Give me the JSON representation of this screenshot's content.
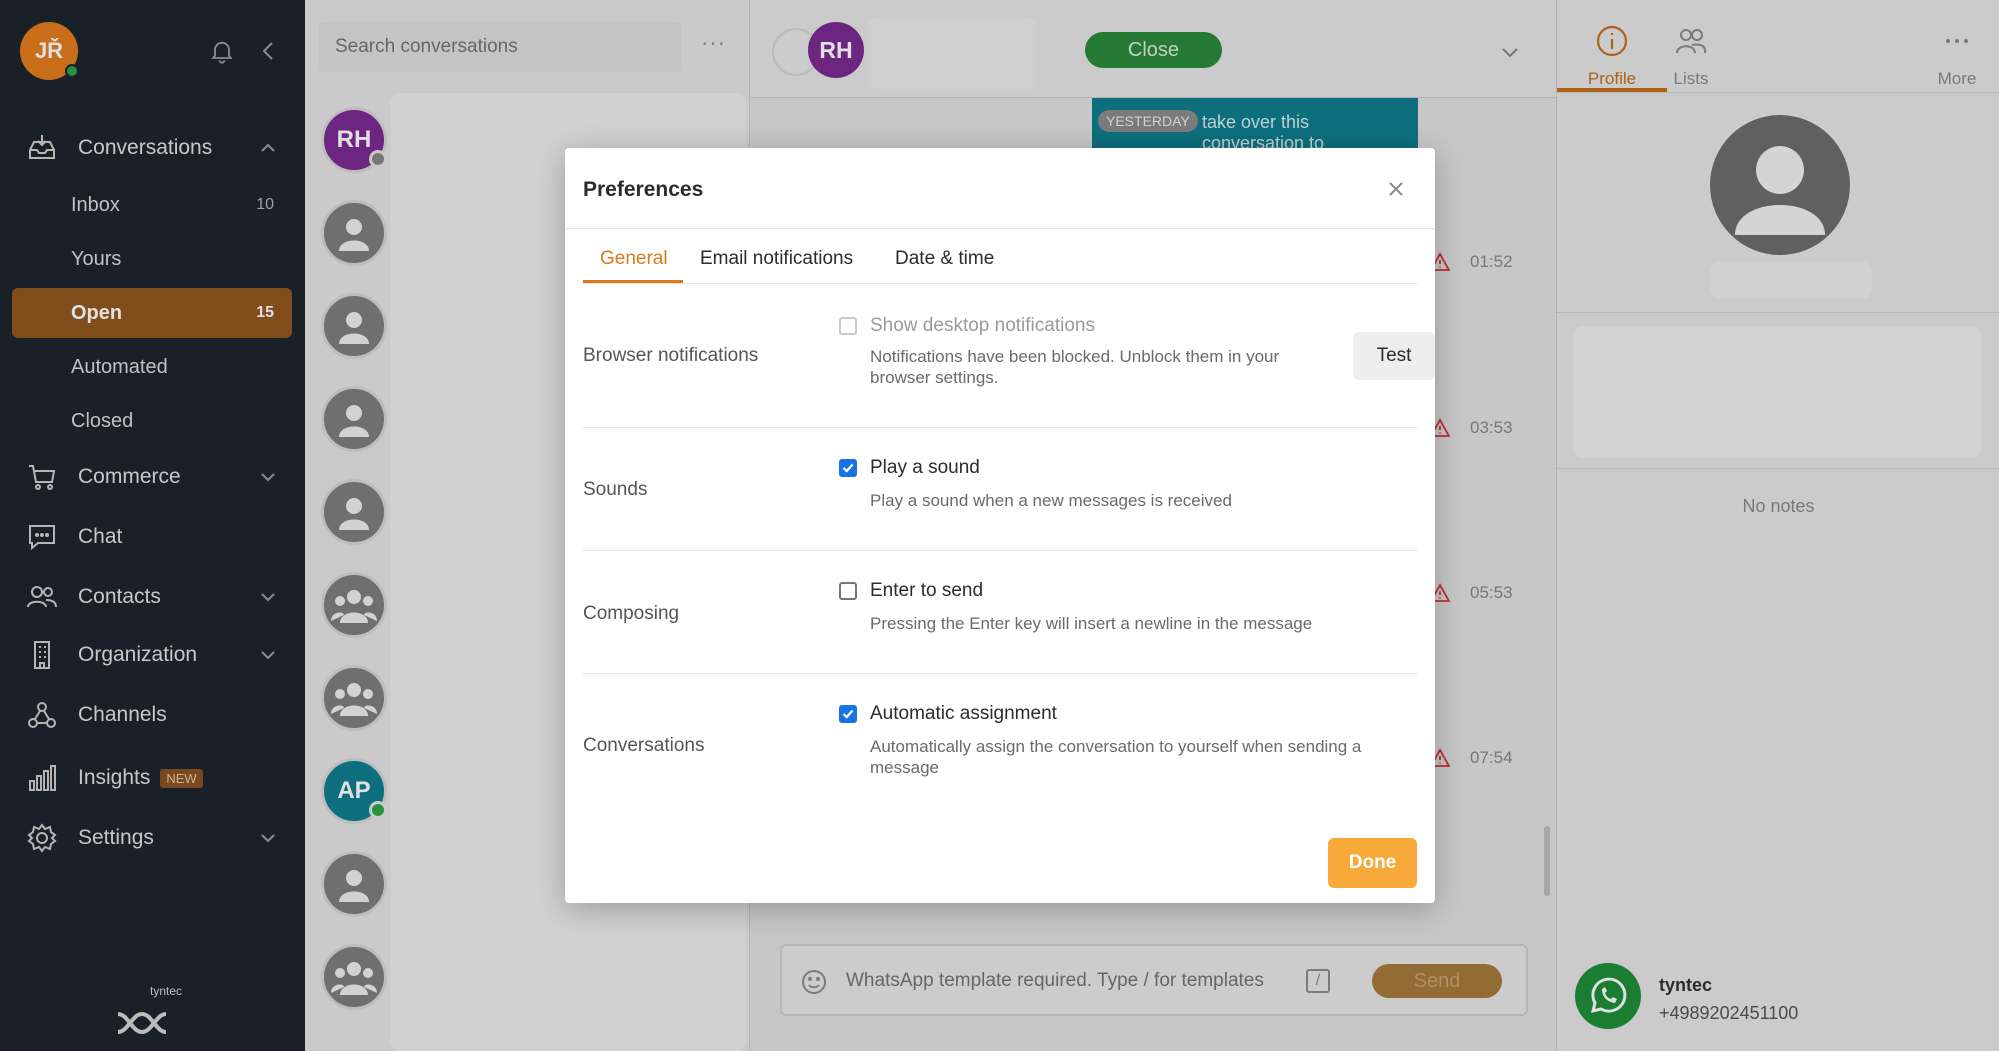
{
  "user": {
    "initials": "JŘ",
    "status_color": "#29a844"
  },
  "sidebar": {
    "conversations": {
      "label": "Conversations",
      "items": [
        {
          "label": "Inbox",
          "count": "10"
        },
        {
          "label": "Yours",
          "count": ""
        },
        {
          "label": "Open",
          "count": "15",
          "active": true
        },
        {
          "label": "Automated",
          "count": ""
        },
        {
          "label": "Closed",
          "count": ""
        }
      ]
    },
    "commerce": "Commerce",
    "chat": "Chat",
    "contacts": "Contacts",
    "organization": "Organization",
    "channels": "Channels",
    "insights": "Insights",
    "insights_badge": "NEW",
    "settings": "Settings",
    "brand": "tyntec",
    "active_color": "#93581f"
  },
  "conv_list": {
    "search_placeholder": "Search conversations",
    "avatars": [
      {
        "initials": "RH",
        "color": "#7b2b92"
      },
      {
        "initials": "AP",
        "color": "#0f7f8f"
      }
    ]
  },
  "chat": {
    "avatar_initials": "RH",
    "close_label": "Close",
    "message_snippet": "take over this conversation to everything's ready for your visit. One short moment",
    "yesterday_label": "YESTERDAY",
    "times": [
      "01:52",
      "03:53",
      "05:53",
      "07:54"
    ],
    "composer_placeholder": "WhatsApp template required. Type / for templates",
    "send_label": "Send"
  },
  "right_panel": {
    "tabs": [
      {
        "label": "Profile",
        "icon": "info-icon",
        "active": true
      },
      {
        "label": "Lists",
        "icon": "users-icon"
      },
      {
        "label": "More",
        "icon": "more-icon"
      }
    ],
    "no_notes": "No notes",
    "channel_name": "tyntec",
    "channel_phone": "+4989202451100"
  },
  "modal": {
    "title": "Preferences",
    "tabs": [
      "General",
      "Email notifications",
      "Date & time"
    ],
    "active_tab": "General",
    "accent_color": "#d97b1a",
    "rows": {
      "browser": {
        "label": "Browser notifications",
        "option": "Show desktop notifications",
        "checked": false,
        "disabled": true,
        "desc": "Notifications have been blocked. Unblock them in your browser settings.",
        "test_label": "Test"
      },
      "sounds": {
        "label": "Sounds",
        "option": "Play a sound",
        "checked": true,
        "desc": "Play a sound when a new messages is received"
      },
      "composing": {
        "label": "Composing",
        "option": "Enter to send",
        "checked": false,
        "desc": "Pressing the Enter key will insert a newline in the message"
      },
      "conversations": {
        "label": "Conversations",
        "option": "Automatic assignment",
        "checked": true,
        "desc": "Automatically assign the conversation to yourself when sending a message"
      }
    },
    "done_label": "Done"
  }
}
